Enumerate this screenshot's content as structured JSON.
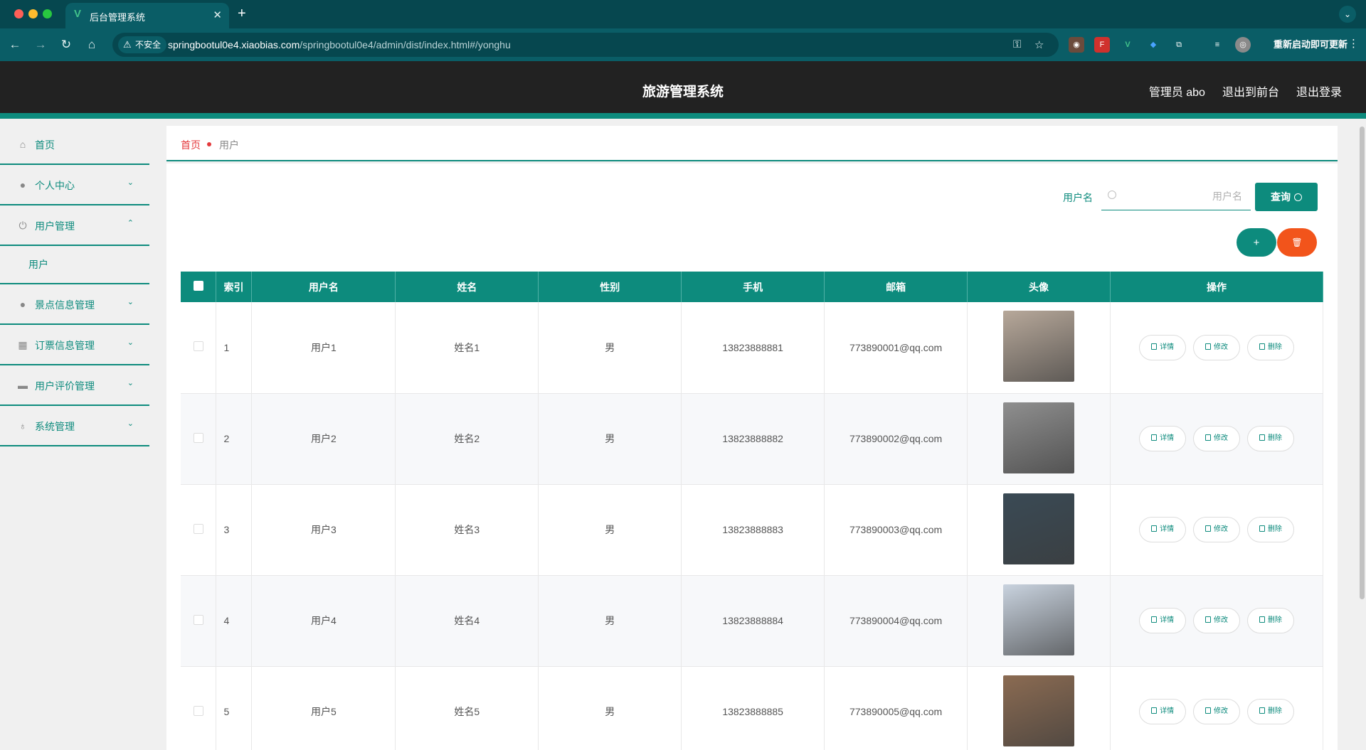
{
  "browser": {
    "tab_title": "后台管理系统",
    "insecure_label": "不安全",
    "url_host": "springbootul0e4.xiaobias.com",
    "url_path": "/springbootul0e4/admin/dist/index.html#/yonghu",
    "relaunch_label": "重新启动即可更新"
  },
  "header": {
    "title": "旅游管理系统",
    "admin_label": "管理员 abo",
    "front_label": "退出到前台",
    "logout_label": "退出登录"
  },
  "sidebar": {
    "items": [
      {
        "label": "首页",
        "icon": "home-icon"
      },
      {
        "label": "个人中心",
        "icon": "user-icon"
      },
      {
        "label": "用户管理",
        "icon": "power-icon"
      },
      {
        "label": "用户",
        "icon": ""
      },
      {
        "label": "景点信息管理",
        "icon": "user-icon"
      },
      {
        "label": "订票信息管理",
        "icon": "grid-icon"
      },
      {
        "label": "用户评价管理",
        "icon": "printer-icon"
      },
      {
        "label": "系统管理",
        "icon": "microphone-icon"
      }
    ]
  },
  "breadcrumb": {
    "home": "首页",
    "current": "用户"
  },
  "search": {
    "label": "用户名",
    "placeholder": "用户名",
    "query_label": "查询"
  },
  "actions": {
    "add_label": "+",
    "delete_label": "🗑"
  },
  "table": {
    "headers": [
      "索引",
      "用户名",
      "姓名",
      "性别",
      "手机",
      "邮箱",
      "头像",
      "操作"
    ],
    "op_labels": {
      "detail": "详情",
      "edit": "修改",
      "delete": "删除"
    },
    "rows": [
      {
        "index": "1",
        "username": "用户1",
        "name": "姓名1",
        "gender": "男",
        "phone": "13823888881",
        "email": "773890001@qq.com",
        "avatar_color": "#b7a89a"
      },
      {
        "index": "2",
        "username": "用户2",
        "name": "姓名2",
        "gender": "男",
        "phone": "13823888882",
        "email": "773890002@qq.com",
        "avatar_color": "#8f8f8f"
      },
      {
        "index": "3",
        "username": "用户3",
        "name": "姓名3",
        "gender": "男",
        "phone": "13823888883",
        "email": "773890003@qq.com",
        "avatar_color": "#3a4a55"
      },
      {
        "index": "4",
        "username": "用户4",
        "name": "姓名4",
        "gender": "男",
        "phone": "13823888884",
        "email": "773890004@qq.com",
        "avatar_color": "#c9d3df"
      },
      {
        "index": "5",
        "username": "用户5",
        "name": "姓名5",
        "gender": "男",
        "phone": "13823888885",
        "email": "773890005@qq.com",
        "avatar_color": "#8b6b52"
      }
    ]
  },
  "colors": {
    "accent": "#0d8b7d",
    "danger": "#f2541b",
    "header_bg": "#222222"
  }
}
